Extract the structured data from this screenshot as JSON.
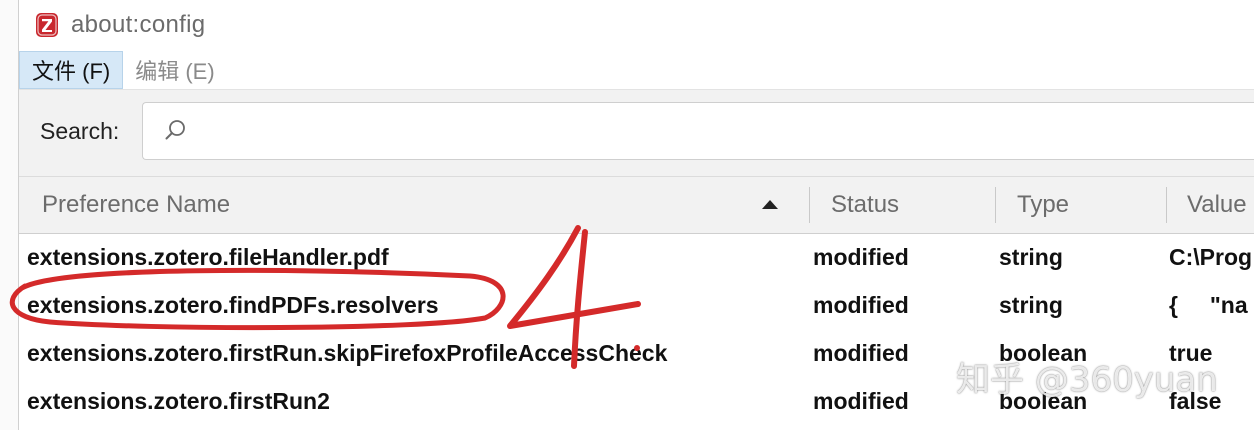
{
  "window": {
    "title": "about:config",
    "app_icon": "zotero-z-icon",
    "accent": "#c8282e"
  },
  "menubar": {
    "items": [
      {
        "label": "文件 (F)",
        "active": true
      },
      {
        "label": "编辑 (E)",
        "active": false
      }
    ]
  },
  "search": {
    "label": "Search:",
    "value": "",
    "icon": "search-icon"
  },
  "table": {
    "columns": [
      "Preference Name",
      "Status",
      "Type",
      "Value"
    ],
    "sort_column": "Preference Name",
    "sort_direction": "ascending",
    "rows": [
      {
        "name": "extensions.zotero.fileHandler.pdf",
        "status": "modified",
        "type": "string",
        "value": "C:\\Prog"
      },
      {
        "name": "extensions.zotero.findPDFs.resolvers",
        "status": "modified",
        "type": "string",
        "value": "{     \"na"
      },
      {
        "name": "extensions.zotero.firstRun.skipFirefoxProfileAccessCheck",
        "status": "modified",
        "type": "boolean",
        "value": "true"
      },
      {
        "name": "extensions.zotero.firstRun2",
        "status": "modified",
        "type": "boolean",
        "value": "false"
      }
    ]
  },
  "annotation": {
    "number": "4",
    "color": "#d42a2a",
    "circled_row": "extensions.zotero.findPDFs.resolvers"
  },
  "watermark": "知乎 @360yuan"
}
